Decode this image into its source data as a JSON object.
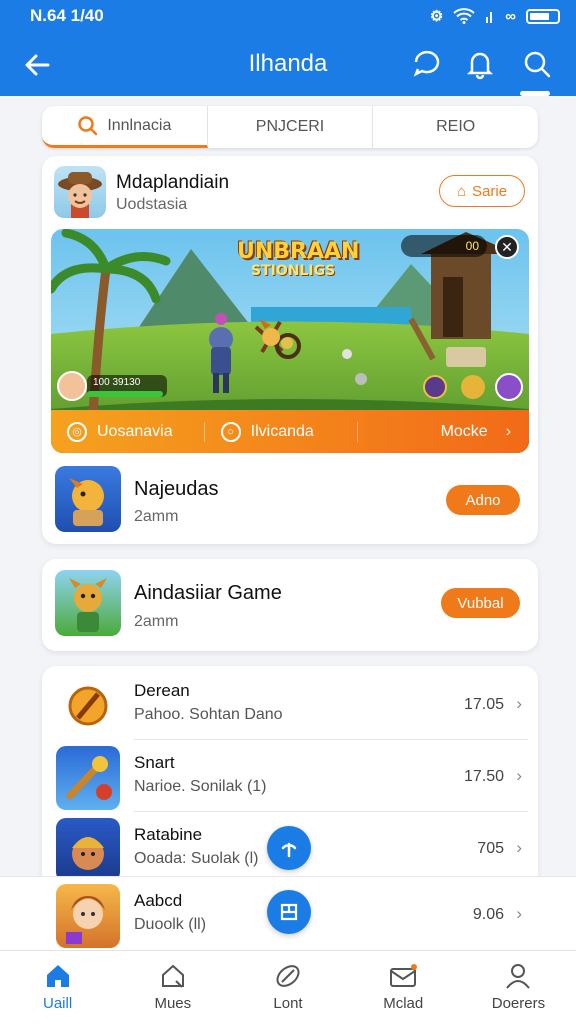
{
  "status_bar": {
    "time": "N.64 1/40"
  },
  "header": {
    "title": "Ilhanda"
  },
  "tabs": [
    {
      "label": "Innlnacia",
      "active": true
    },
    {
      "label": "PNJCERI",
      "active": false
    },
    {
      "label": "REIO",
      "active": false
    }
  ],
  "featured": {
    "name": "Mdaplandiain",
    "subtitle": "Uodstasia",
    "action_label": "Sarie",
    "banner": {
      "game_title_line1": "UNBRAAN",
      "game_title_line2": "STIONLIGS",
      "hud_stat": "100 39130",
      "top_counter": "00"
    },
    "bar_items": [
      "Uosanavia",
      "Ilvicanda",
      "Mocke"
    ]
  },
  "game_items": [
    {
      "name": "Najeudas",
      "meta": "2amm",
      "action_label": "Adno",
      "style": "outline"
    },
    {
      "name": "Aindasiiar Game",
      "meta": "2amm",
      "action_label": "Vubbal",
      "style": "filled"
    }
  ],
  "list_items": [
    {
      "name": "Derean",
      "subtitle": "Pahoo. Sohtan Dano",
      "price": "17.05"
    },
    {
      "name": "Snart",
      "subtitle": "Narioe. Sonilak (1)",
      "price": "17.50"
    },
    {
      "name": "Ratabine",
      "subtitle": "Ooada: Suolak (l)",
      "price": "705"
    },
    {
      "name": "Aabcd",
      "subtitle": "Duoolk (ll)",
      "price": "9.06"
    }
  ],
  "bottom_nav": [
    {
      "label": "Uaill",
      "icon": "home-icon",
      "active": true
    },
    {
      "label": "Mues",
      "icon": "house-outline-icon",
      "active": false
    },
    {
      "label": "Lont",
      "icon": "pencil-icon",
      "active": false
    },
    {
      "label": "Mclad",
      "icon": "mail-icon",
      "active": false
    },
    {
      "label": "Doerers",
      "icon": "profile-icon",
      "active": false
    }
  ],
  "colors": {
    "primary": "#1a7ce4",
    "accent": "#f07a1a"
  }
}
